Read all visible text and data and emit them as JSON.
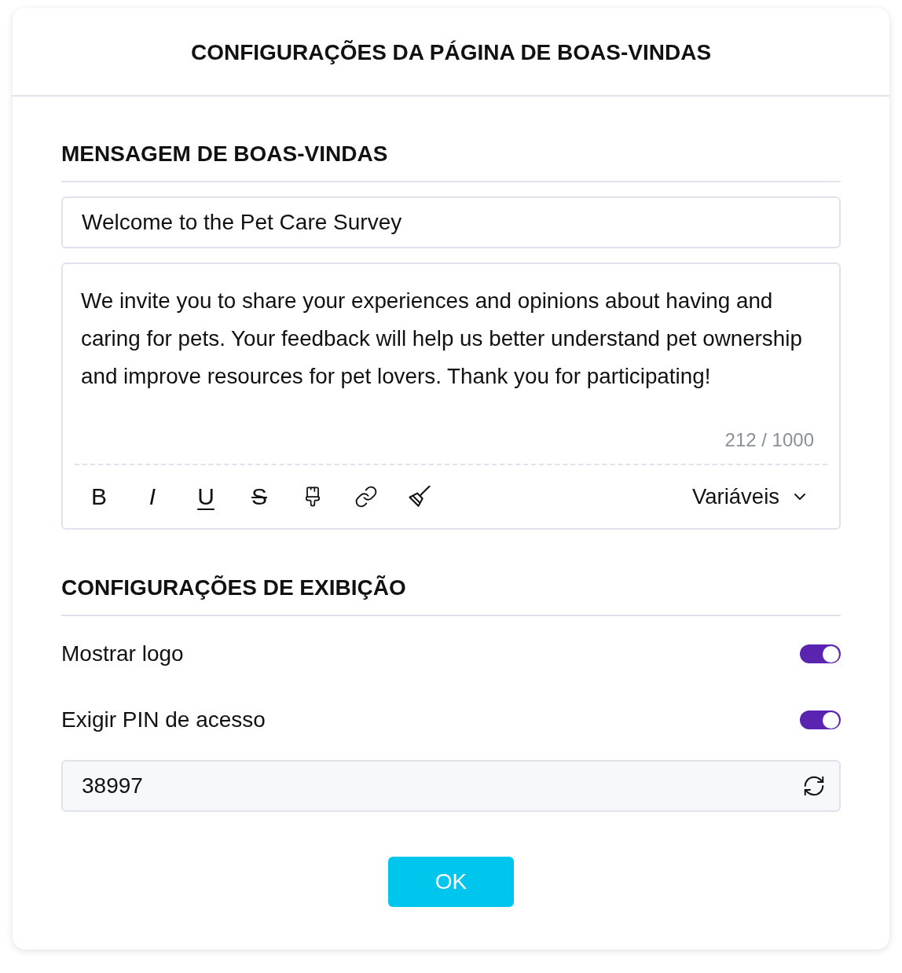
{
  "dialog": {
    "title": "CONFIGURAÇÕES DA PÁGINA DE BOAS-VINDAS"
  },
  "welcome_message": {
    "heading": "MENSAGEM DE BOAS-VINDAS",
    "title_value": "Welcome to the Pet Care Survey",
    "body_value": "We invite you to share your experiences and opinions about having and caring for pets. Your feedback will help us better understand pet ownership and improve resources for pet lovers. Thank you for participating!",
    "counter": "212 / 1000",
    "toolbar": [
      {
        "kind": "bold",
        "label": "B"
      },
      {
        "kind": "italic",
        "label": "I"
      },
      {
        "kind": "underline",
        "label": "U"
      },
      {
        "kind": "strikethrough",
        "label": "S"
      },
      {
        "kind": "brush"
      },
      {
        "kind": "link"
      },
      {
        "kind": "clear"
      }
    ],
    "variables_menu": "Variáveis"
  },
  "display_settings": {
    "heading": "CONFIGURAÇÕES DE EXIBIÇÃO",
    "toggles": [
      {
        "label": "Mostrar logo",
        "on": true
      },
      {
        "label": "Exigir PIN de acesso",
        "on": true
      }
    ],
    "pin_value": "38997"
  },
  "ok_button": "OK"
}
